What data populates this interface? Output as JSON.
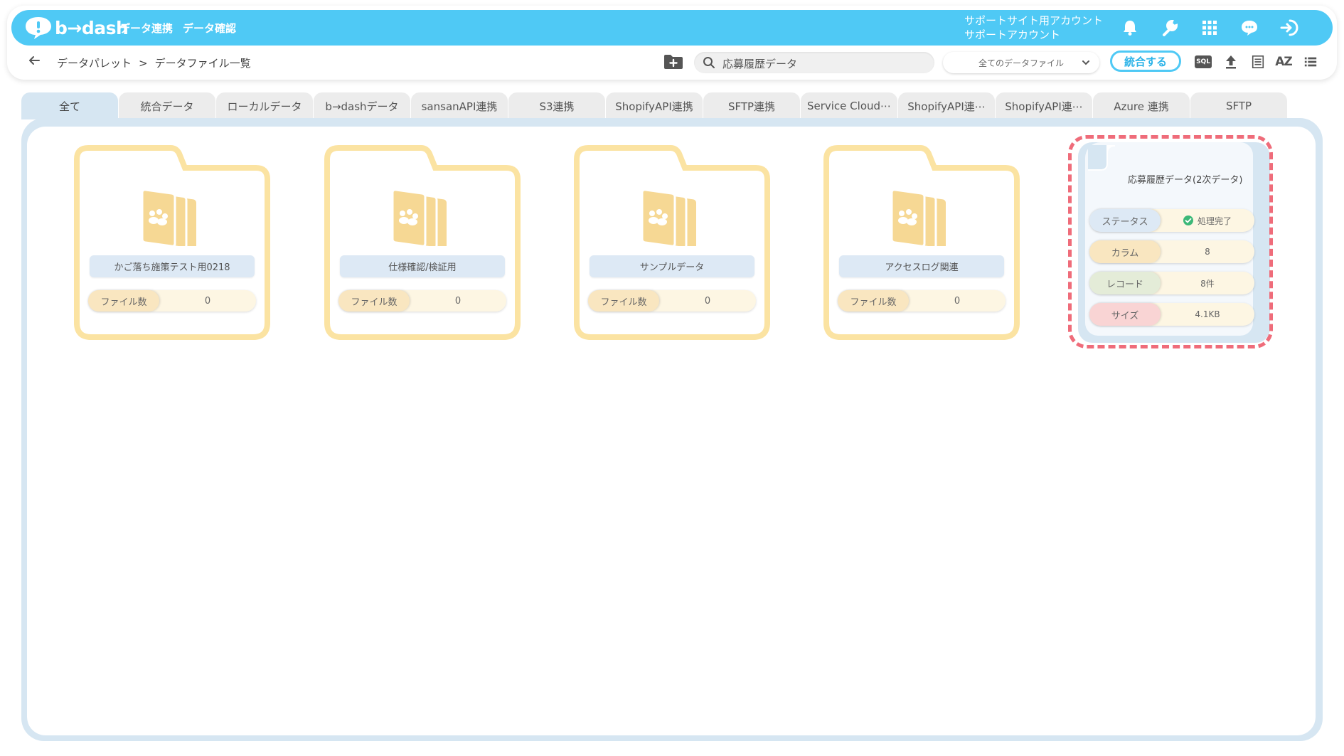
{
  "header": {
    "logo_text": "b→dash",
    "nav": [
      "データ連携",
      "データ確認"
    ],
    "account_line1": "サポートサイト用アカウント",
    "account_line2": "サポートアカウント"
  },
  "breadcrumb": [
    "データパレット",
    ">",
    "データファイル一覧"
  ],
  "search": {
    "value": "応募履歴データ",
    "placeholder": "応募履歴データ"
  },
  "filter": {
    "selected": "全てのデータファイル"
  },
  "merge_button": "統合する",
  "toolbar": {
    "sql_label": "SQL",
    "az_label": "AZ"
  },
  "tabs": [
    "全て",
    "統合データ",
    "ローカルデータ",
    "b→dashデータ",
    "sansanAPI連携",
    "S3連携",
    "ShopifyAPI連携",
    "SFTP連携",
    "Service Cloud⋯",
    "ShopifyAPI連⋯",
    "ShopifyAPI連⋯",
    "Azure 連携",
    "SFTP"
  ],
  "active_tab": "全て",
  "folders": [
    {
      "name": "かご落ち施策テスト用0218",
      "count_label": "ファイル数",
      "count": "0"
    },
    {
      "name": "仕様確認/検証用",
      "count_label": "ファイル数",
      "count": "0"
    },
    {
      "name": "サンプルデータ",
      "count_label": "ファイル数",
      "count": "0"
    },
    {
      "name": "アクセスログ関連",
      "count_label": "ファイル数",
      "count": "0"
    }
  ],
  "data_file": {
    "title": "応募履歴データ(2次データ)",
    "stats": [
      {
        "label": "ステータス",
        "value": "処理完了",
        "color": "#dde9f5"
      },
      {
        "label": "カラム",
        "value": "8",
        "color": "#f9e6c0"
      },
      {
        "label": "レコード",
        "value": "8件",
        "color": "#e4ecd8"
      },
      {
        "label": "サイズ",
        "value": "4.1KB",
        "color": "#f9d4d4"
      }
    ]
  },
  "colors": {
    "brand": "#4fc9f5",
    "folder_border": "#fbe3a2",
    "highlight": "#ef6c7a",
    "status_ok": "#3cb878"
  }
}
